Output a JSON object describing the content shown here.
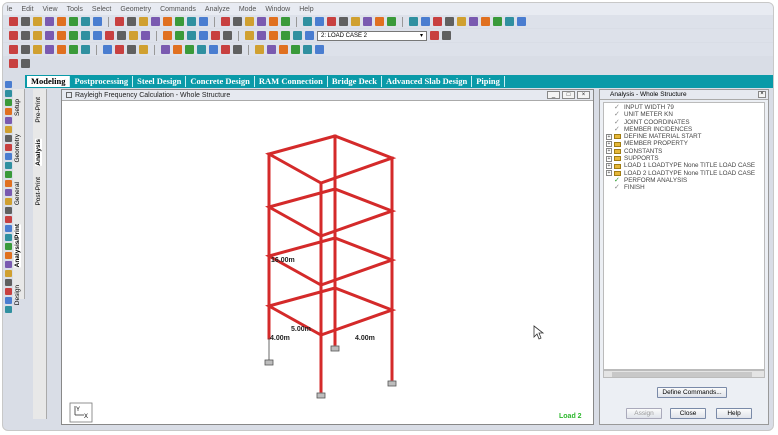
{
  "menubar": [
    "le",
    "Edit",
    "View",
    "Tools",
    "Select",
    "Geometry",
    "Commands",
    "Analyze",
    "Mode",
    "Window",
    "Help"
  ],
  "toolbar": {
    "load_case_value": "2: LOAD CASE 2"
  },
  "tabs": [
    {
      "label": "Modeling",
      "active": true
    },
    {
      "label": "Postprocessing",
      "active": false
    },
    {
      "label": "Steel Design",
      "active": false
    },
    {
      "label": "Concrete Design",
      "active": false
    },
    {
      "label": "RAM Connection",
      "active": false
    },
    {
      "label": "Bridge Deck",
      "active": false
    },
    {
      "label": "Advanced Slab Design",
      "active": false
    },
    {
      "label": "Piping",
      "active": false
    }
  ],
  "vtabs_outer": [
    "Setup",
    "Geometry",
    "General",
    "Analysis/Print",
    "Design"
  ],
  "vtabs_inner": [
    "Pre-Print",
    "Analysis",
    "Post-Print"
  ],
  "viewport": {
    "title": "Rayleigh Frequency Calculation - Whole Structure",
    "dim_height": "16.00m",
    "dim_width": "5.00m",
    "dim_depth_left": "4.00m",
    "dim_depth_right": "4.00m",
    "load_label": "Load 2",
    "axis_x": "X",
    "axis_y": "Y"
  },
  "right_panel": {
    "title": "Analysis - Whole Structure",
    "tree": [
      {
        "label": "INPUT WIDTH 79",
        "type": "check"
      },
      {
        "label": "UNIT METER KN",
        "type": "check"
      },
      {
        "label": "JOINT COORDINATES",
        "type": "check"
      },
      {
        "label": "MEMBER INCIDENCES",
        "type": "check"
      },
      {
        "label": "DEFINE MATERIAL START",
        "type": "folder"
      },
      {
        "label": "MEMBER PROPERTY",
        "type": "folder"
      },
      {
        "label": "CONSTANTS",
        "type": "folder"
      },
      {
        "label": "SUPPORTS",
        "type": "folder"
      },
      {
        "label": "LOAD 1 LOADTYPE None  TITLE LOAD CASE",
        "type": "folder"
      },
      {
        "label": "LOAD 2 LOADTYPE None  TITLE LOAD CASE",
        "type": "folder"
      },
      {
        "label": "PERFORM ANALYSIS",
        "type": "green"
      },
      {
        "label": "FINISH",
        "type": "check"
      }
    ],
    "define_button": "Define Commands...",
    "assign_button": "Assign",
    "close_button": "Close",
    "help_button": "Help"
  },
  "colors": {
    "accent": "#0a9aa8",
    "member": "#d42a2a",
    "load_label": "#2db82d"
  }
}
